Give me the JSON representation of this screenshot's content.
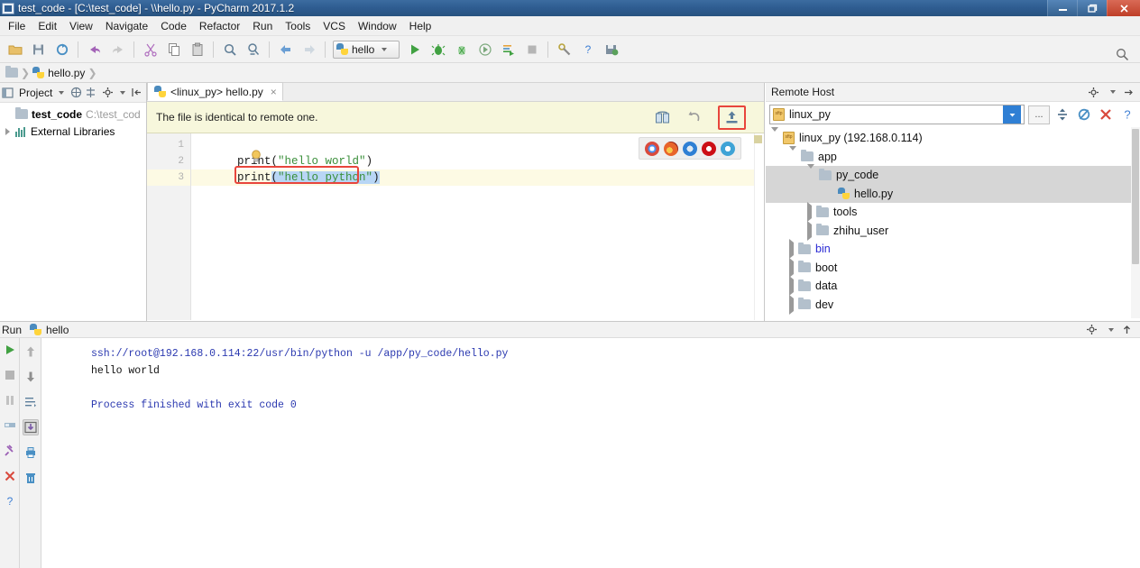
{
  "window": {
    "title": "test_code - [C:\\test_code] - \\\\hello.py - PyCharm 2017.1.2",
    "minimize_label": "–",
    "restore_label": "❐",
    "close_label": "✕"
  },
  "menubar": {
    "items": [
      {
        "label": "File"
      },
      {
        "label": "Edit"
      },
      {
        "label": "View"
      },
      {
        "label": "Navigate"
      },
      {
        "label": "Code"
      },
      {
        "label": "Refactor"
      },
      {
        "label": "Run"
      },
      {
        "label": "Tools"
      },
      {
        "label": "VCS"
      },
      {
        "label": "Window"
      },
      {
        "label": "Help"
      }
    ]
  },
  "toolbar": {
    "buttons": [
      {
        "name": "open-folder-icon"
      },
      {
        "name": "save-all-icon"
      },
      {
        "name": "sync-icon"
      },
      {
        "name": "undo-icon"
      },
      {
        "name": "redo-icon"
      },
      {
        "name": "cut-icon"
      },
      {
        "name": "copy-icon"
      },
      {
        "name": "paste-icon"
      },
      {
        "name": "find-icon"
      },
      {
        "name": "replace-icon"
      },
      {
        "name": "back-icon"
      },
      {
        "name": "forward-icon"
      }
    ],
    "run_config": "hello",
    "run_label": "Run",
    "debug_label": "Debug",
    "coverage_label": "Run with Coverage",
    "profile_label": "Profile",
    "console_label": "Run with Console",
    "stop_label": "Stop",
    "settings_label": "Settings",
    "help_label": "?",
    "deploy_label": "Deploy",
    "search_label": "Search"
  },
  "breadcrumb": {
    "file": "hello.py"
  },
  "project_panel": {
    "title": "Project",
    "root": {
      "name": "test_code",
      "path": "C:\\test_cod"
    },
    "external_libraries": "External Libraries"
  },
  "editor": {
    "tab": {
      "label": "<linux_py> hello.py",
      "close": "×"
    },
    "notification": {
      "message": "The file is identical to remote one.",
      "diff_label": "Compare",
      "revert_label": "Revert",
      "upload_label": "Upload"
    },
    "lines": [
      {
        "number": "1",
        "text": "",
        "current": false
      },
      {
        "number": "2",
        "text": "print(\"hello world\")",
        "current": false
      },
      {
        "number": "3",
        "text": "print(\"hello python\")",
        "current": true
      }
    ],
    "code_line2_call": "print",
    "code_line2_string": "\"hello world\"",
    "code_line3_call": "print",
    "code_line3_string": "\"hello python\"",
    "browsers": [
      {
        "name": "chrome-icon",
        "color": "#d94a3d"
      },
      {
        "name": "firefox-icon",
        "color": "#e8642b"
      },
      {
        "name": "safari-icon",
        "color": "#2f7fd4"
      },
      {
        "name": "opera-icon",
        "color": "#cc0f16"
      },
      {
        "name": "edge-icon",
        "color": "#3fa3d6"
      }
    ]
  },
  "remote_host": {
    "title": "Remote Host",
    "connection": "linux_py",
    "browse_label": "...",
    "collapse_label": "Collapse All",
    "refresh_label": "Refresh",
    "close_label": "✕",
    "help_label": "?",
    "tree": [
      {
        "label": "linux_py (192.168.0.114)",
        "depth": 0,
        "expanded": true,
        "icon": "sftp",
        "selected": false,
        "blue": false
      },
      {
        "label": "app",
        "depth": 1,
        "expanded": true,
        "icon": "folder",
        "selected": false,
        "blue": false
      },
      {
        "label": "py_code",
        "depth": 2,
        "expanded": true,
        "icon": "folder",
        "selected": true,
        "blue": false
      },
      {
        "label": "hello.py",
        "depth": 3,
        "expanded": null,
        "icon": "python",
        "selected": true,
        "blue": false
      },
      {
        "label": "tools",
        "depth": 2,
        "expanded": false,
        "icon": "folder",
        "selected": false,
        "blue": false
      },
      {
        "label": "zhihu_user",
        "depth": 2,
        "expanded": false,
        "icon": "folder",
        "selected": false,
        "blue": false
      },
      {
        "label": "bin",
        "depth": 1,
        "expanded": false,
        "icon": "folder",
        "selected": false,
        "blue": true
      },
      {
        "label": "boot",
        "depth": 1,
        "expanded": false,
        "icon": "folder",
        "selected": false,
        "blue": false
      },
      {
        "label": "data",
        "depth": 1,
        "expanded": false,
        "icon": "folder",
        "selected": false,
        "blue": false
      },
      {
        "label": "dev",
        "depth": 1,
        "expanded": false,
        "icon": "folder",
        "selected": false,
        "blue": false
      }
    ]
  },
  "run_panel": {
    "title": "Run",
    "config_name": "hello",
    "tools": [
      {
        "name": "rerun-button",
        "label": "Rerun"
      },
      {
        "name": "stop-button",
        "label": "Stop"
      },
      {
        "name": "pause-button",
        "label": "Pause"
      },
      {
        "name": "resume-button",
        "label": "Resume"
      },
      {
        "name": "pin-tab-button",
        "label": "Pin Tab"
      },
      {
        "name": "close-button",
        "label": "Close"
      },
      {
        "name": "help-button",
        "label": "Help"
      }
    ],
    "tools2": [
      {
        "name": "up-arrow-button",
        "label": "Up"
      },
      {
        "name": "down-arrow-button",
        "label": "Down"
      },
      {
        "name": "soft-wrap-button",
        "label": "Soft-Wrap"
      },
      {
        "name": "scroll-to-end-button",
        "label": "Scroll to End"
      },
      {
        "name": "print-button",
        "label": "Print"
      },
      {
        "name": "clear-all-button",
        "label": "Clear All"
      }
    ],
    "output": [
      {
        "text": "ssh://root@192.168.0.114:22/usr/bin/python -u /app/py_code/hello.py",
        "style": "blue"
      },
      {
        "text": "hello world",
        "style": "black"
      },
      {
        "text": "",
        "style": "blank"
      },
      {
        "text": "Process finished with exit code 0",
        "style": "blue"
      }
    ]
  },
  "colors": {
    "title_bar": "#2f5d92",
    "notification_bg": "#f7f7dc",
    "highlight_red": "#e8453c",
    "accent_blue": "#2f7fd4",
    "string_green": "#3a8f3a"
  }
}
